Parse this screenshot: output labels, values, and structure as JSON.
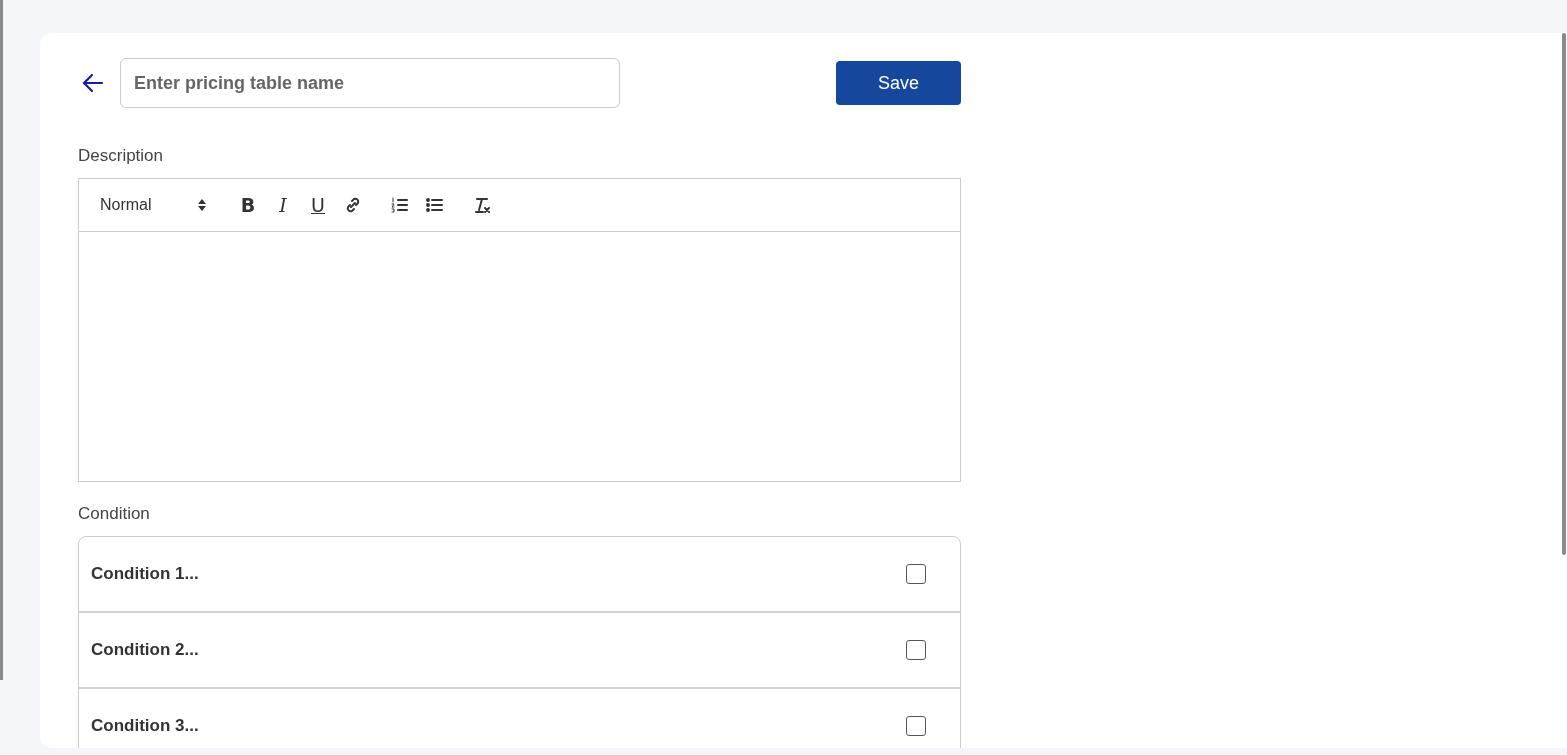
{
  "header": {
    "name_field": {
      "placeholder": "Enter pricing table name"
    },
    "save_button": "Save"
  },
  "description": {
    "label": "Description",
    "toolbar": {
      "format": "Normal",
      "buttons": [
        {
          "kind": "bold",
          "label": "B"
        },
        {
          "kind": "italic",
          "label": "I"
        },
        {
          "kind": "underline",
          "label": "U"
        },
        {
          "kind": "link"
        },
        {
          "kind": "ordered-list"
        },
        {
          "kind": "bullet-list"
        },
        {
          "kind": "clear-format"
        }
      ]
    }
  },
  "condition": {
    "label": "Condition",
    "items": [
      {
        "text": "Condition 1...",
        "checked": false
      },
      {
        "text": "Condition 2...",
        "checked": false
      },
      {
        "text": "Condition 3...",
        "checked": false
      }
    ]
  }
}
